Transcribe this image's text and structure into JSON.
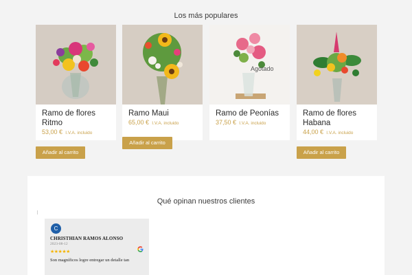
{
  "popular": {
    "title": "Los más populares",
    "products": [
      {
        "name": "Ramo de flores Ritmo",
        "price": "53,00 €",
        "tax_note": "I.V.A. incluido",
        "button_label": "Añadir al carrito",
        "image": "bouquet-ritmo-image"
      },
      {
        "name": "Ramo Maui",
        "price": "65,00 €",
        "tax_note": "I.V.A. incluido",
        "button_label": "Añadir al carrito",
        "image": "bouquet-maui-image"
      },
      {
        "name": "Ramo de Peonías",
        "price": "37,50 €",
        "tax_note": "I.V.A. incluido",
        "overlay_label": "Agotado",
        "image": "bouquet-peonias-image"
      },
      {
        "name": "Ramo de flores Habana",
        "price": "44,00 €",
        "tax_note": "I.V.A. incluido",
        "button_label": "Añadir al carrito",
        "image": "bouquet-habana-image"
      }
    ]
  },
  "reviews": {
    "title": "Qué opinan nuestros clientes",
    "items": [
      {
        "avatar_letter": "C",
        "author": "CHRISTHIAN RAMOS ALONSO",
        "date": "2023-08-12",
        "stars": "★★★★★",
        "text": "Son magníficos logre entregar un detalle tan",
        "source_icon": "google-icon"
      }
    ]
  },
  "colors": {
    "accent": "#c9a14a",
    "avatar": "#1f5fa8",
    "stars": "#f5b400"
  }
}
